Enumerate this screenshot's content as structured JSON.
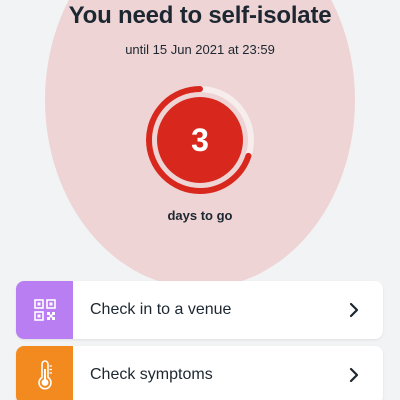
{
  "header": {
    "title": "You need to self-isolate",
    "until_text": "until 15 Jun 2021 at 23:59"
  },
  "countdown": {
    "days_remaining": "3",
    "label": "days to go",
    "ring_progress": 0.7
  },
  "actions": [
    {
      "label": "Check in to a venue",
      "icon": "qr-code-icon",
      "icon_bg": "#b97ef2"
    },
    {
      "label": "Check symptoms",
      "icon": "thermometer-icon",
      "icon_bg": "#f28a1f"
    }
  ],
  "colors": {
    "accent_red": "#d8281e",
    "halo": "#eed4d4",
    "ring_track": "#f7eded",
    "text": "#1d2731"
  }
}
